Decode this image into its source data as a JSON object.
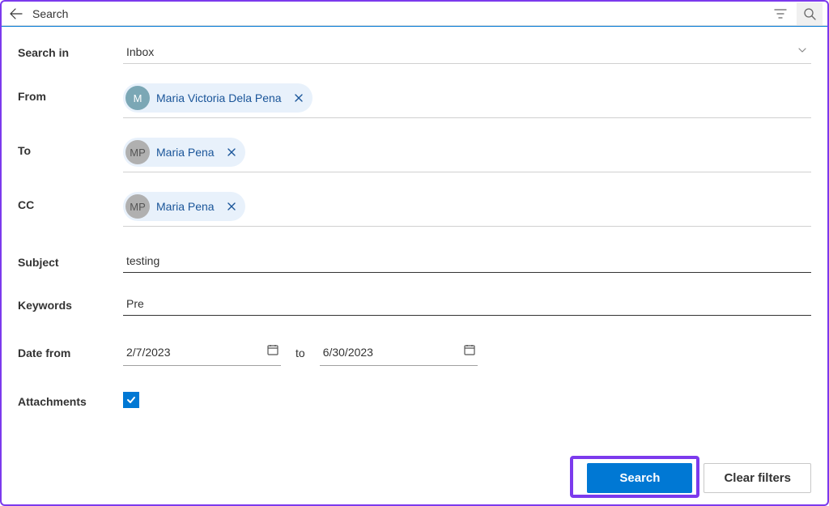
{
  "header": {
    "title": "Search"
  },
  "form": {
    "search_in_label": "Search in",
    "search_in_value": "Inbox",
    "from_label": "From",
    "from_chips": [
      {
        "avatar": "M",
        "name": "Maria Victoria Dela Pena",
        "avatarClass": "teal"
      }
    ],
    "to_label": "To",
    "to_chips": [
      {
        "avatar": "MP",
        "name": "Maria Pena",
        "avatarClass": "grey"
      }
    ],
    "cc_label": "CC",
    "cc_chips": [
      {
        "avatar": "MP",
        "name": "Maria Pena",
        "avatarClass": "grey"
      }
    ],
    "subject_label": "Subject",
    "subject_value": "testing",
    "keywords_label": "Keywords",
    "keywords_value": "Pre",
    "date_from_label": "Date from",
    "date_from_value": "2/7/2023",
    "date_to_label": "to",
    "date_to_value": "6/30/2023",
    "attachments_label": "Attachments",
    "attachments_checked": true
  },
  "buttons": {
    "search": "Search",
    "clear": "Clear filters"
  }
}
